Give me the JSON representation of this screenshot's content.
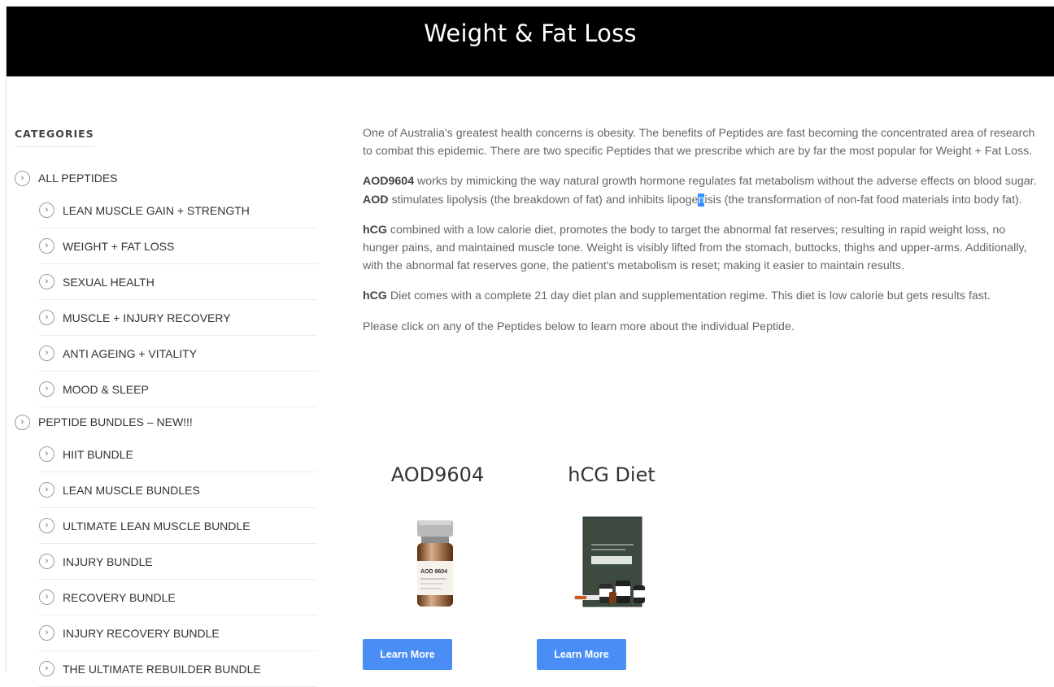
{
  "header": {
    "title": "Weight & Fat Loss"
  },
  "sidebar": {
    "heading": "CATEGORIES",
    "items": [
      {
        "label": "ALL PEPTIDES",
        "level": 0
      },
      {
        "label": "LEAN MUSCLE GAIN + STRENGTH",
        "level": 1
      },
      {
        "label": "WEIGHT + FAT LOSS",
        "level": 1
      },
      {
        "label": "SEXUAL HEALTH",
        "level": 1
      },
      {
        "label": "MUSCLE + INJURY RECOVERY",
        "level": 1
      },
      {
        "label": "ANTI AGEING + VITALITY",
        "level": 1
      },
      {
        "label": "MOOD & SLEEP",
        "level": 1
      },
      {
        "label": "PEPTIDE BUNDLES – NEW!!!",
        "level": 0
      },
      {
        "label": "HIIT BUNDLE",
        "level": 1
      },
      {
        "label": "LEAN MUSCLE BUNDLES",
        "level": 1
      },
      {
        "label": "ULTIMATE LEAN MUSCLE BUNDLE",
        "level": 1
      },
      {
        "label": "INJURY BUNDLE",
        "level": 1
      },
      {
        "label": "RECOVERY BUNDLE",
        "level": 1
      },
      {
        "label": "INJURY RECOVERY BUNDLE",
        "level": 1
      },
      {
        "label": "THE ULTIMATE REBUILDER BUNDLE",
        "level": 1
      }
    ]
  },
  "content": {
    "intro": "One of Australia's greatest health concerns is obesity. The benefits of Peptides are fast becoming the concentrated area of research to combat this epidemic. There are two specific Peptides that we prescribe which are by far the most popular for Weight + Fat Loss.",
    "aod_bold1": "AOD9604",
    "aod_text1": " works by mimicking the way natural growth hormone regulates fat metabolism without the adverse effects on blood sugar. ",
    "aod_bold2": "AOD",
    "aod_text2a": " stimulates lipolysis (the breakdown of fat) and inhibits lipoge",
    "aod_highlight": "n",
    "aod_text2b": "isis (the transformation of non-fat food materials into body fat).",
    "hcg_bold": "hCG",
    "hcg_text": " combined with a low calorie diet, promotes the body to target the abnormal fat reserves; resulting in rapid weight loss, no hunger pains, and maintained muscle tone. Weight is visibly lifted from the stomach, buttocks, thighs and upper-arms. Additionally, with the abnormal fat reserves gone, the patient's metabolism is reset; making it easier to maintain results.",
    "diet_bold": "hCG",
    "diet_text": " Diet comes with a complete 21 day diet plan and supplementation regime. This diet is low calorie but gets results fast.",
    "click_text": "Please click on any of the Peptides below to learn more about the individual Peptide."
  },
  "products": [
    {
      "name": "AOD9604",
      "vial_label": "AOD 9604",
      "button": "Learn More"
    },
    {
      "name": "hCG Diet",
      "button": "Learn More"
    }
  ],
  "colors": {
    "header_bg": "#000000",
    "button_bg": "#4a8ef5",
    "highlight": "#3390ff"
  }
}
